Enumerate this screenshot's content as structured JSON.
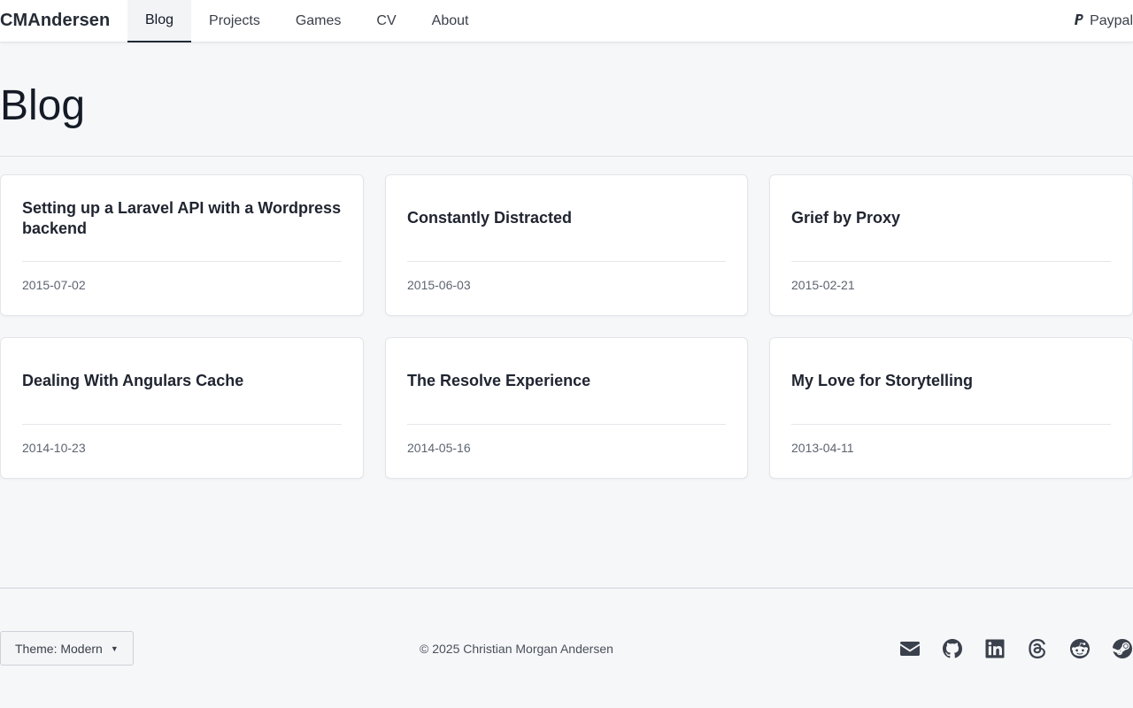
{
  "header": {
    "brand": "CMAndersen",
    "nav": [
      {
        "label": "Blog",
        "active": true
      },
      {
        "label": "Projects",
        "active": false
      },
      {
        "label": "Games",
        "active": false
      },
      {
        "label": "CV",
        "active": false
      },
      {
        "label": "About",
        "active": false
      }
    ],
    "paypal_label": "Paypal",
    "paypal_icon": "paypal-icon"
  },
  "page": {
    "title": "Blog"
  },
  "posts": [
    {
      "title": "Setting up a Laravel API with a Wordpress backend",
      "date": "2015-07-02"
    },
    {
      "title": "Constantly Distracted",
      "date": "2015-06-03"
    },
    {
      "title": "Grief by Proxy",
      "date": "2015-02-21"
    },
    {
      "title": "Dealing With Angulars Cache",
      "date": "2014-10-23"
    },
    {
      "title": "The Resolve Experience",
      "date": "2014-05-16"
    },
    {
      "title": "My Love for Storytelling",
      "date": "2013-04-11"
    }
  ],
  "footer": {
    "theme_label": "Theme: Modern",
    "copyright": "© 2025 Christian Morgan Andersen",
    "social_icons": [
      "email-icon",
      "github-icon",
      "linkedin-icon",
      "threads-icon",
      "reddit-icon",
      "steam-icon"
    ]
  },
  "colors": {
    "background": "#f6f7f9",
    "card": "#ffffff",
    "text": "#1f2430",
    "muted": "#5d6470"
  }
}
